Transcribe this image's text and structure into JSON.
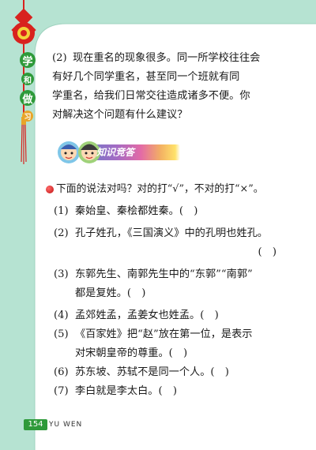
{
  "side_title": [
    "学",
    "和",
    "做",
    "习"
  ],
  "question_2": {
    "number": "(2)",
    "lines": [
      "现在重名的现象很多。同一所学校往往会",
      "有好几个同学重名，甚至同一个班就有同",
      "学重名，给我们日常交往造成诸多不便。你",
      "对解决这个问题有什么建议？"
    ]
  },
  "section": {
    "title": "知识竞答"
  },
  "instruction": "下面的说法对吗？对的打“√”，不对的打“×”。",
  "items": [
    {
      "n": "(1)",
      "lines": [
        "秦始皇、秦桧都姓秦。(　)"
      ]
    },
    {
      "n": "(2)",
      "lines": [
        "孔子姓孔，《三国演义》中的孔明也姓孔。"
      ],
      "trailing": "(　)"
    },
    {
      "n": "(3)",
      "lines": [
        "东郭先生、南郭先生中的“东郭”“南郭”",
        "都是复姓。(　)"
      ]
    },
    {
      "n": "(4)",
      "lines": [
        "孟郊姓孟，孟姜女也姓孟。(　)"
      ]
    },
    {
      "n": "(5)",
      "lines": [
        "《百家姓》把“赵”放在第一位，是表示",
        "对宋朝皇帝的尊重。(　)"
      ]
    },
    {
      "n": "(6)",
      "lines": [
        "苏东坡、苏轼不是同一个人。(　)"
      ]
    },
    {
      "n": "(7)",
      "lines": [
        "李白就是李太白。(　)"
      ]
    }
  ],
  "footer": {
    "page_number": "154",
    "label": "YU WEN"
  },
  "colors": {
    "band": "#b6e3d2",
    "green": "#2e9a3a",
    "knot": "#d8221e",
    "bullet": "#c01010"
  }
}
